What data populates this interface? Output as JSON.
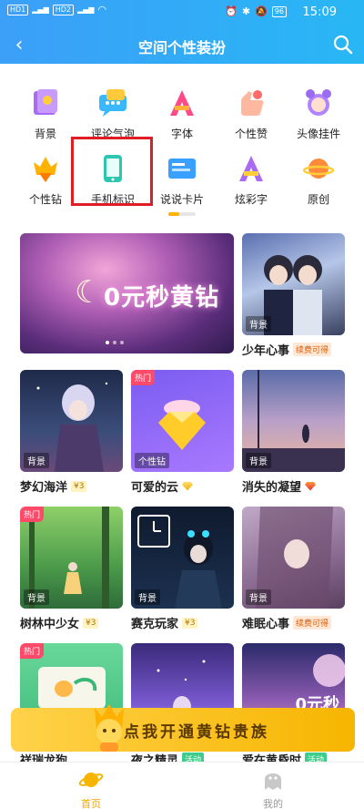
{
  "status": {
    "left": "HD1 HD2 46 46",
    "battery": "96",
    "time": "15:09"
  },
  "header": {
    "title": "空间个性装扮"
  },
  "categories": [
    {
      "label": "背景"
    },
    {
      "label": "评论气泡"
    },
    {
      "label": "字体"
    },
    {
      "label": "个性赞"
    },
    {
      "label": "头像挂件"
    },
    {
      "label": "个性钻"
    },
    {
      "label": "手机标识"
    },
    {
      "label": "说说卡片"
    },
    {
      "label": "炫彩字"
    },
    {
      "label": "原创"
    }
  ],
  "banner": {
    "text": "0元秒黄钻"
  },
  "cards": [
    {
      "name": "少年心事",
      "tag": "续费可得",
      "caption": "背景",
      "hot": ""
    },
    {
      "name": "梦幻海洋",
      "tag": "¥3",
      "caption": "背景",
      "hot": ""
    },
    {
      "name": "可爱的云",
      "tag": "",
      "caption": "个性钻",
      "hot": "热门"
    },
    {
      "name": "消失的凝望",
      "tag": "",
      "caption": "背景",
      "hot": ""
    },
    {
      "name": "树林中少女",
      "tag": "¥3",
      "caption": "背景",
      "hot": "热门"
    },
    {
      "name": "赛克玩家",
      "tag": "¥3",
      "caption": "背景",
      "hot": ""
    },
    {
      "name": "难眠心事",
      "tag": "续费可得",
      "caption": "背景",
      "hot": ""
    },
    {
      "name": "祥瑞龙狗",
      "tag": "",
      "caption": "",
      "hot": "热门"
    },
    {
      "name": "夜之精灵",
      "tag": "活动",
      "caption": "",
      "hot": ""
    },
    {
      "name": "爱在黄昏时",
      "tag": "活动",
      "caption": "",
      "hot": ""
    }
  ],
  "small_banner_text": "0元秒",
  "cta": {
    "label": "点我开通黄钻贵族"
  },
  "nav": {
    "home": "首页",
    "me": "我的"
  },
  "colors": {
    "header": "#3c9ff8",
    "accent": "#f7b500",
    "highlight": "#e01c24"
  }
}
